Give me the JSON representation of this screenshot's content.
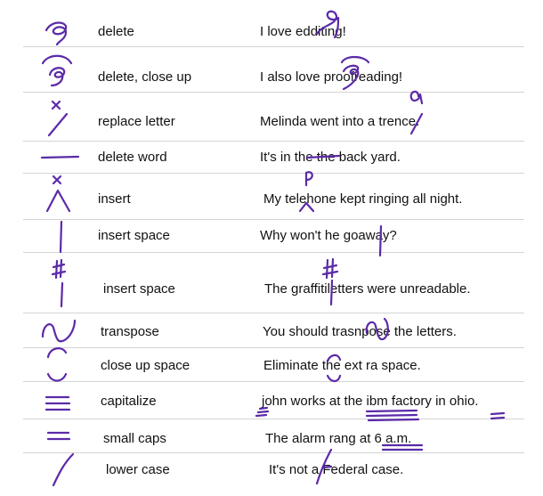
{
  "rows": [
    {
      "name": "delete",
      "example": "I love edditing!"
    },
    {
      "name": "delete, close up",
      "example": "I also love proofreading!"
    },
    {
      "name": "replace letter",
      "example": "Melinda went into a trence."
    },
    {
      "name": "delete word",
      "example": "It's in the the back yard."
    },
    {
      "name": "insert",
      "example": "My telehone kept ringing all night."
    },
    {
      "name": "insert space",
      "example": "Why won't he goaway?"
    },
    {
      "name": "insert space",
      "example": "The graffitiletters were unreadable."
    },
    {
      "name": "transpose",
      "example": "You should trasnpose the letters."
    },
    {
      "name": "close up space",
      "example": "Eliminate the ext ra space."
    },
    {
      "name": "capitalize",
      "example": "john works at the ibm factory in ohio."
    },
    {
      "name": "small caps",
      "example": "The alarm rang at 6 a.m."
    },
    {
      "name": "lower case",
      "example": "It's not a Federal case."
    }
  ],
  "marks": {
    "replace_letter": "a",
    "insert_letter": "p",
    "insert_space": "#"
  },
  "ink_color": "#5b2aa8"
}
